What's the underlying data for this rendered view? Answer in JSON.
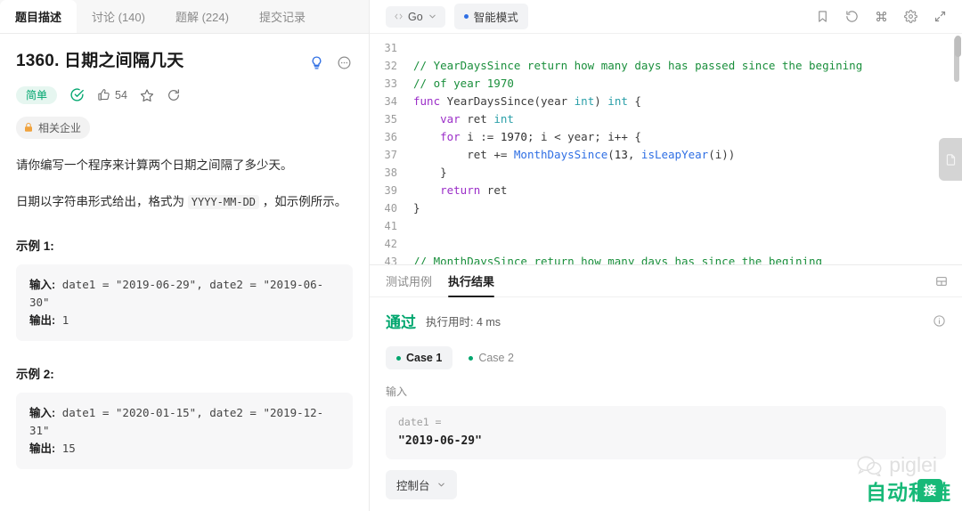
{
  "left": {
    "tabs": [
      {
        "label": "题目描述",
        "active": true
      },
      {
        "label": "讨论 (140)",
        "active": false
      },
      {
        "label": "题解 (224)",
        "active": false
      },
      {
        "label": "提交记录",
        "active": false
      }
    ],
    "problem": {
      "title": "1360. 日期之间隔几天",
      "difficulty": "简单",
      "likes": "54",
      "company_badge": "相关企业",
      "paragraph1": "请你编写一个程序来计算两个日期之间隔了多少天。",
      "paragraph2_before": "日期以字符串形式给出，格式为 ",
      "paragraph2_code": "YYYY-MM-DD",
      "paragraph2_after": " ，如示例所示。"
    },
    "examples": [
      {
        "title": "示例 1:",
        "input_label": "输入:",
        "input_value": " date1 = \"2019-06-29\", date2 = \"2019-06-30\"",
        "output_label": "输出:",
        "output_value": " 1"
      },
      {
        "title": "示例 2:",
        "input_label": "输入:",
        "input_value": " date1 = \"2020-01-15\", date2 = \"2019-12-31\"",
        "output_label": "输出:",
        "output_value": " 15"
      }
    ],
    "icons": {
      "lightbulb": "lightbulb-icon",
      "more": "more-icon",
      "solved_check": "check-circle-icon",
      "like": "thumbs-up-icon",
      "star": "star-icon",
      "share": "share-icon",
      "lock": "lock-icon"
    }
  },
  "editor": {
    "language": "Go",
    "smart_mode": "智能模式",
    "toolbar_icons": [
      "bookmark-icon",
      "reset-icon",
      "command-icon",
      "gear-icon",
      "expand-icon"
    ],
    "lines": [
      {
        "no": "31",
        "tokens": []
      },
      {
        "no": "32",
        "tokens": [
          {
            "t": "// YearDaysSince return how many days has passed since the begining",
            "c": "c"
          }
        ]
      },
      {
        "no": "33",
        "tokens": [
          {
            "t": "// of year 1970",
            "c": "c"
          }
        ]
      },
      {
        "no": "34",
        "tokens": [
          {
            "t": "func ",
            "c": "k"
          },
          {
            "t": "YearDaysSince",
            "c": "p"
          },
          {
            "t": "(",
            "c": "p"
          },
          {
            "t": "year ",
            "c": "p"
          },
          {
            "t": "int",
            "c": "t"
          },
          {
            "t": ") ",
            "c": "p"
          },
          {
            "t": "int",
            "c": "t"
          },
          {
            "t": " {",
            "c": "p"
          }
        ]
      },
      {
        "no": "35",
        "tokens": [
          {
            "t": "    ",
            "c": "p"
          },
          {
            "t": "var ",
            "c": "k"
          },
          {
            "t": "ret ",
            "c": "p"
          },
          {
            "t": "int",
            "c": "t"
          }
        ]
      },
      {
        "no": "36",
        "tokens": [
          {
            "t": "    ",
            "c": "p"
          },
          {
            "t": "for ",
            "c": "k"
          },
          {
            "t": "i := ",
            "c": "p"
          },
          {
            "t": "1970",
            "c": "num"
          },
          {
            "t": "; i < year; i++ {",
            "c": "p"
          }
        ]
      },
      {
        "no": "37",
        "tokens": [
          {
            "t": "        ",
            "c": "p"
          },
          {
            "t": "ret += ",
            "c": "p"
          },
          {
            "t": "MonthDaysSince",
            "c": "f"
          },
          {
            "t": "(",
            "c": "p"
          },
          {
            "t": "13",
            "c": "num"
          },
          {
            "t": ", ",
            "c": "p"
          },
          {
            "t": "isLeapYear",
            "c": "f"
          },
          {
            "t": "(i))",
            "c": "p"
          }
        ]
      },
      {
        "no": "38",
        "tokens": [
          {
            "t": "    }",
            "c": "p"
          }
        ]
      },
      {
        "no": "39",
        "tokens": [
          {
            "t": "    ",
            "c": "p"
          },
          {
            "t": "return ",
            "c": "k"
          },
          {
            "t": "ret",
            "c": "p"
          }
        ]
      },
      {
        "no": "40",
        "tokens": [
          {
            "t": "}",
            "c": "p"
          }
        ]
      },
      {
        "no": "41",
        "tokens": []
      },
      {
        "no": "42",
        "tokens": []
      },
      {
        "no": "43",
        "tokens": [
          {
            "t": "// MonthDaysSince return how many days has since the begining",
            "c": "c"
          }
        ]
      }
    ]
  },
  "result": {
    "tabs": [
      {
        "label": "测试用例",
        "active": false
      },
      {
        "label": "执行结果",
        "active": true
      }
    ],
    "layout_icon": "layout-icon",
    "status": "通过",
    "runtime": "执行用时: 4 ms",
    "info_icon": "info-icon",
    "cases": [
      {
        "label": "Case 1",
        "active": true
      },
      {
        "label": "Case 2",
        "active": false
      }
    ],
    "input_section_label": "输入",
    "input_key": "date1 =",
    "input_value": "\"2019-06-29\"",
    "console_label": "控制台"
  },
  "edge_tab": {
    "icon": "document-icon"
  },
  "watermarks": {
    "piglei": "piglei",
    "green_text": "自动秒链",
    "green_pill": "接"
  },
  "colors": {
    "accent_green": "#00a66e",
    "keyword_purple": "#9b2ec8",
    "type_teal": "#2a9fa8",
    "function_blue": "#2f6fe4",
    "comment_green": "#1a8f3c",
    "watermark_green": "#17b978"
  }
}
